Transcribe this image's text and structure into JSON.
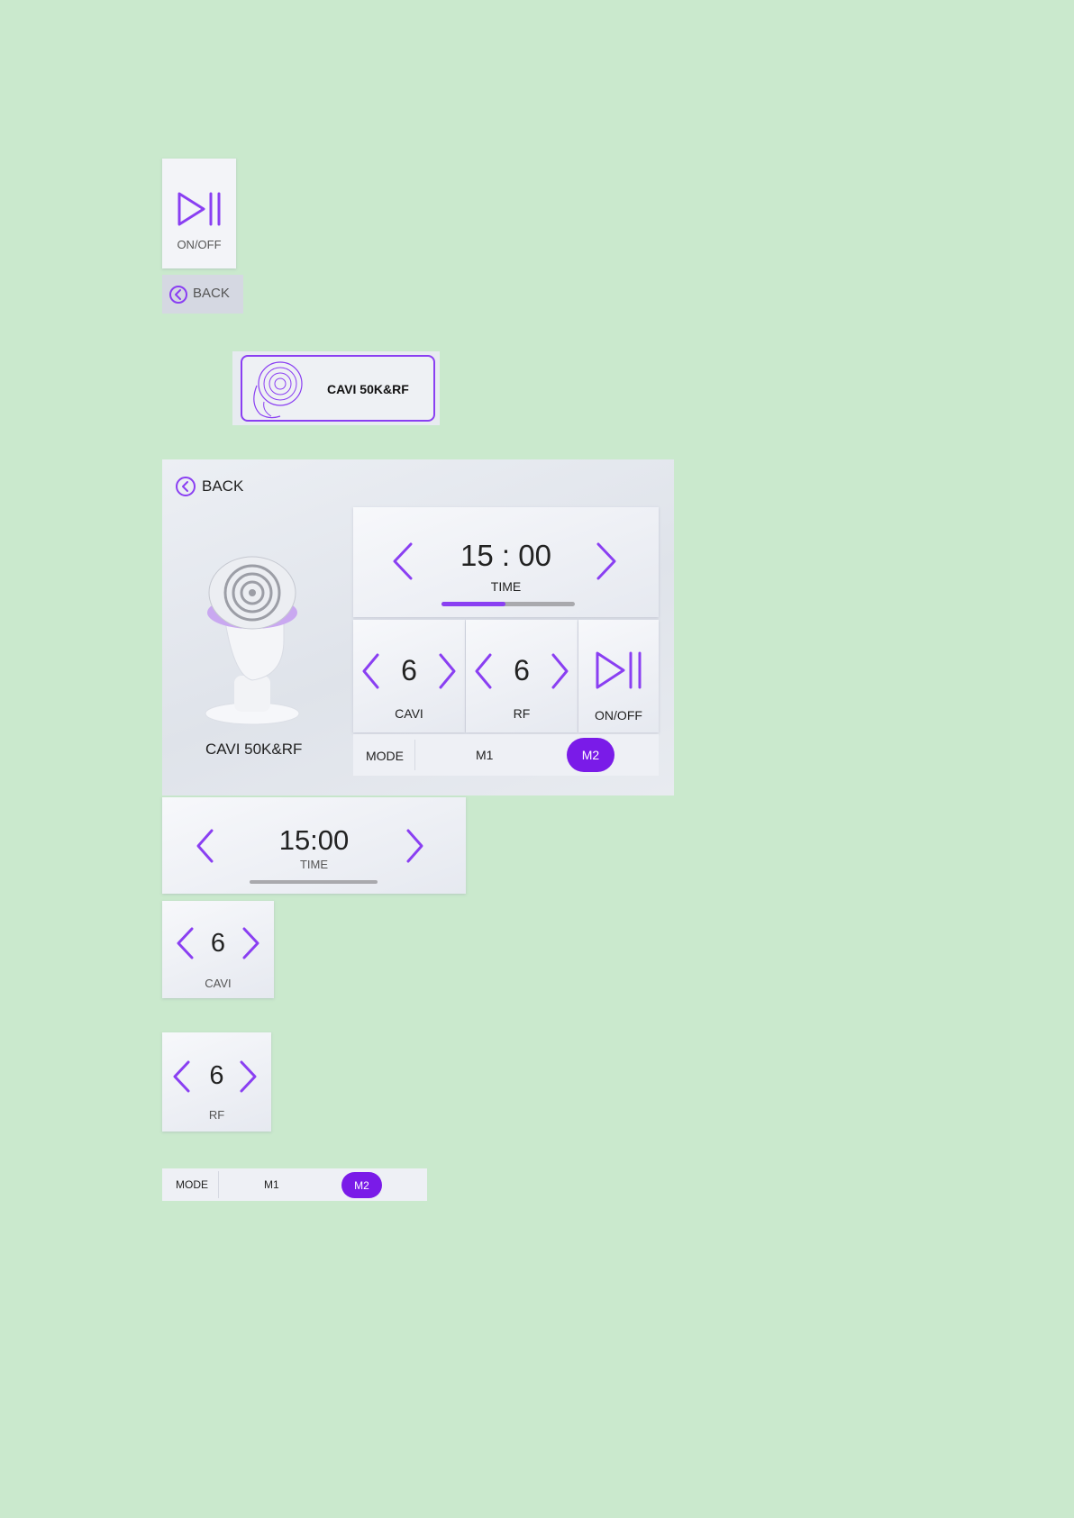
{
  "onoff_icon": {
    "label": "ON/OFF",
    "icon": "play-pause-icon"
  },
  "back_button": {
    "label": "BACK",
    "icon": "chevron-left-circle-icon"
  },
  "mode_card": {
    "title": "CAVI 50K&RF",
    "icon": "device-head-icon"
  },
  "panel": {
    "back_label": "BACK",
    "device_name": "CAVI 50K&RF",
    "time": {
      "value": "15 : 00",
      "label": "TIME",
      "progress": 0.48
    },
    "cavi": {
      "value": "6",
      "label": "CAVI"
    },
    "rf": {
      "value": "6",
      "label": "RF"
    },
    "onoff_label": "ON/OFF",
    "mode": {
      "label": "MODE",
      "options": [
        "M1",
        "M2"
      ],
      "selected": "M2"
    }
  },
  "time_component": {
    "value": "15:00",
    "label": "TIME",
    "progress": 0
  },
  "cavi_component": {
    "value": "6",
    "label": "CAVI"
  },
  "rf_component": {
    "value": "6",
    "label": "RF"
  },
  "mode_component": {
    "label": "MODE",
    "options": [
      "M1",
      "M2"
    ],
    "selected": "M2"
  },
  "colors": {
    "background": "#cae9cd",
    "accent": "#8a3ff2",
    "pill": "#7a1be8",
    "track": "#a9a9ad"
  }
}
